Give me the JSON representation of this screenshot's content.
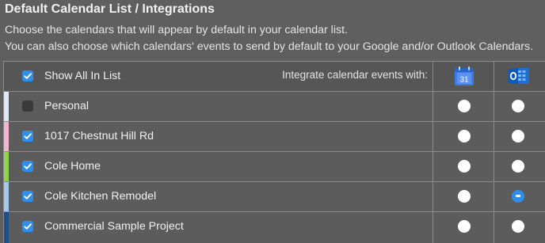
{
  "title": "Default Calendar List / Integrations",
  "description": [
    "Choose the calendars that will appear by default in your calendar list.",
    "You can also choose which calendars' events to send by default to your Google and/or Outlook Calendars."
  ],
  "header": {
    "show_all_label": "Show All In List",
    "show_all_checked": true,
    "integrate_label": "Integrate calendar events with:",
    "google_icon": "google-calendar-icon",
    "google_icon_text": "31",
    "outlook_icon": "outlook-calendar-icon"
  },
  "calendars": [
    {
      "label": "Personal",
      "checked": false,
      "color": "#dfe8f4",
      "google": false,
      "outlook": false
    },
    {
      "label": "1017 Chestnut Hill Rd",
      "checked": true,
      "color": "#f3b6cf",
      "google": false,
      "outlook": false
    },
    {
      "label": "Cole Home",
      "checked": true,
      "color": "#8fd34f",
      "google": false,
      "outlook": false
    },
    {
      "label": "Cole Kitchen Remodel",
      "checked": true,
      "color": "#a7c7ea",
      "google": false,
      "outlook": true
    },
    {
      "label": "Commercial Sample Project",
      "checked": true,
      "color": "#1f4f88",
      "google": false,
      "outlook": false
    }
  ],
  "colors": {
    "background": "#5f5f5f",
    "accent": "#2f8eea",
    "border": "#8b8b8b"
  }
}
